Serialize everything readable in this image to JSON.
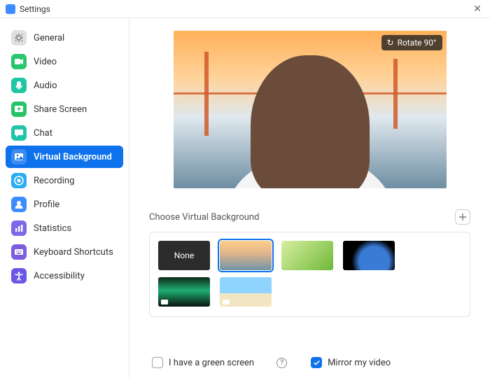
{
  "window": {
    "title": "Settings"
  },
  "sidebar": {
    "items": [
      {
        "label": "General",
        "icon": "gear-icon",
        "color": "#e0e0e0"
      },
      {
        "label": "Video",
        "icon": "video-icon",
        "color": "#27c56d"
      },
      {
        "label": "Audio",
        "icon": "audio-icon",
        "color": "#1fc6a3"
      },
      {
        "label": "Share Screen",
        "icon": "share-screen-icon",
        "color": "#25c466"
      },
      {
        "label": "Chat",
        "icon": "chat-icon",
        "color": "#20c4a7"
      },
      {
        "label": "Virtual Background",
        "icon": "virtual-background-icon",
        "color": "#0e72ec",
        "active": true
      },
      {
        "label": "Recording",
        "icon": "recording-icon",
        "color": "#2aadf0"
      },
      {
        "label": "Profile",
        "icon": "profile-icon",
        "color": "#3d8cff"
      },
      {
        "label": "Statistics",
        "icon": "statistics-icon",
        "color": "#7d68e8"
      },
      {
        "label": "Keyboard Shortcuts",
        "icon": "keyboard-icon",
        "color": "#7c5de0"
      },
      {
        "label": "Accessibility",
        "icon": "accessibility-icon",
        "color": "#6b57e6"
      }
    ]
  },
  "rotate_label": "Rotate 90°",
  "section_title": "Choose Virtual Background",
  "thumbs": {
    "none_label": "None",
    "items": [
      {
        "name": "none"
      },
      {
        "name": "golden-gate-bridge",
        "selected": true
      },
      {
        "name": "grass"
      },
      {
        "name": "earth-from-space"
      },
      {
        "name": "aurora"
      },
      {
        "name": "beach"
      }
    ]
  },
  "checks": {
    "green_screen_label": "I have a green screen",
    "mirror_label": "Mirror my video",
    "green_screen_checked": false,
    "mirror_checked": true
  }
}
